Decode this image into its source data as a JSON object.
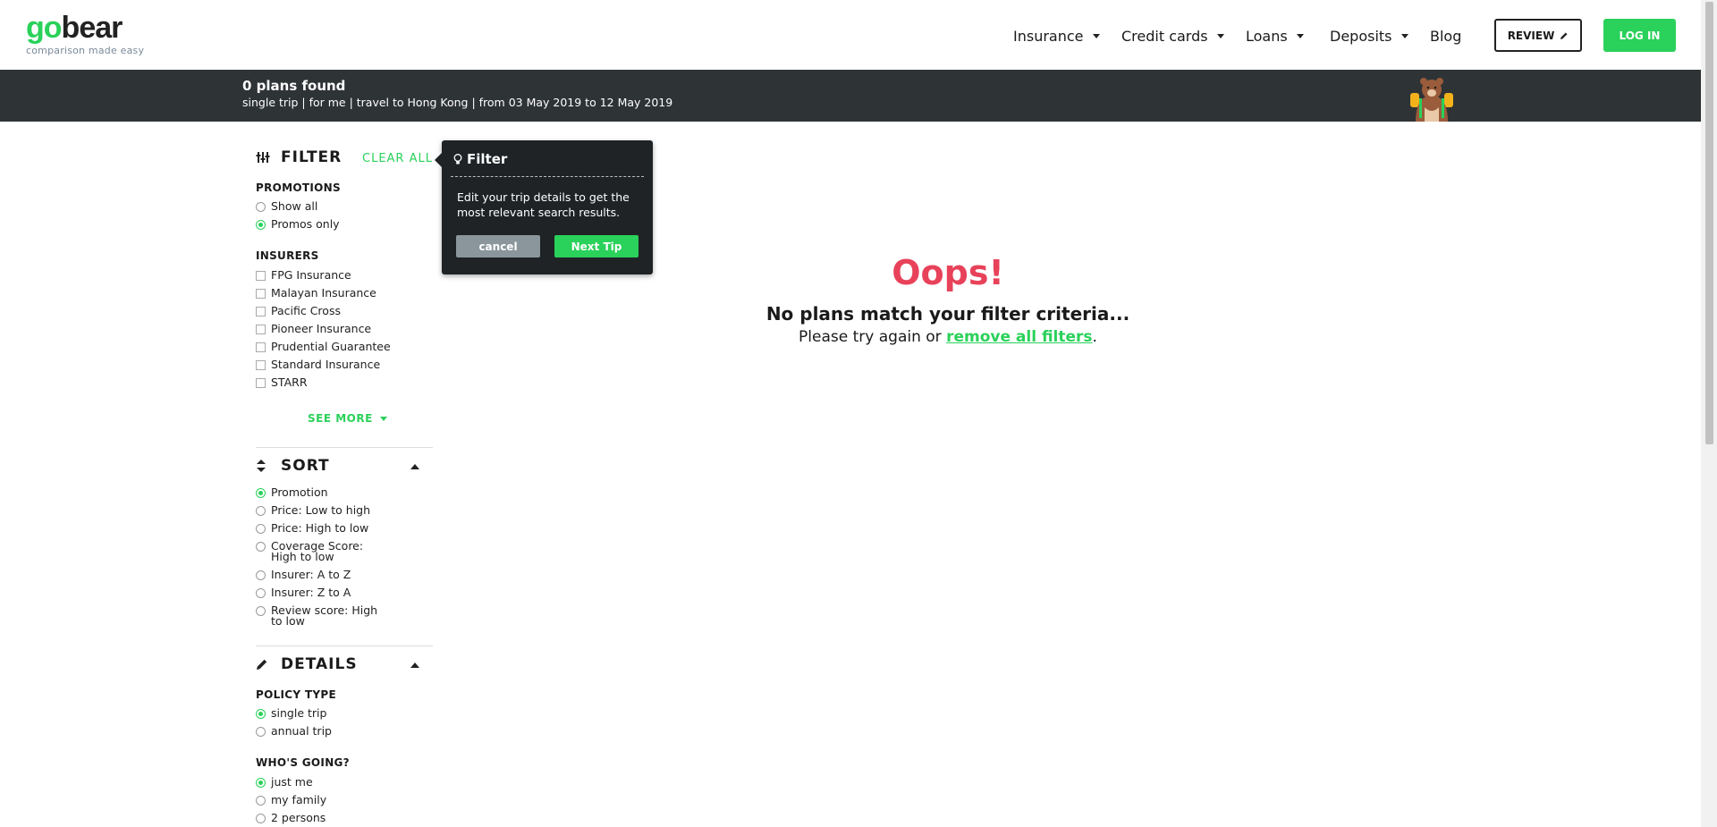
{
  "header": {
    "logo_go": "go",
    "logo_bear": "bear",
    "logo_tagline": "comparison made easy",
    "nav": [
      {
        "label": "Insurance",
        "dropdown": true
      },
      {
        "label": "Credit cards",
        "dropdown": true
      },
      {
        "label": "Loans",
        "dropdown": true
      },
      {
        "label": "Deposits",
        "dropdown": true
      },
      {
        "label": "Blog",
        "dropdown": false
      }
    ],
    "review_label": "REVIEW",
    "login_label": "LOG IN"
  },
  "summary": {
    "title": "0 plans found",
    "subtitle": "single trip | for me | travel to Hong Kong | from 03 May 2019 to 12 May 2019"
  },
  "filter": {
    "title": "FILTER",
    "clear_all": "CLEAR ALL",
    "promotions": {
      "label": "PROMOTIONS",
      "options": [
        {
          "label": "Show all",
          "selected": false
        },
        {
          "label": "Promos only",
          "selected": true
        }
      ]
    },
    "insurers": {
      "label": "INSURERS",
      "options": [
        {
          "label": "FPG Insurance",
          "checked": false
        },
        {
          "label": "Malayan Insurance",
          "checked": false
        },
        {
          "label": "Pacific Cross",
          "checked": false
        },
        {
          "label": "Pioneer Insurance",
          "checked": false
        },
        {
          "label": "Prudential Guarantee",
          "checked": false
        },
        {
          "label": "Standard Insurance",
          "checked": false
        },
        {
          "label": "STARR",
          "checked": false
        }
      ]
    },
    "see_more": "SEE MORE"
  },
  "sort": {
    "title": "SORT",
    "options": [
      {
        "label": "Promotion",
        "selected": true
      },
      {
        "label": "Price: Low to high",
        "selected": false
      },
      {
        "label": "Price: High to low",
        "selected": false
      },
      {
        "label": "Coverage Score: High to low",
        "selected": false
      },
      {
        "label": "Insurer: A to Z",
        "selected": false
      },
      {
        "label": "Insurer: Z to A",
        "selected": false
      },
      {
        "label": "Review score: High to low",
        "selected": false
      }
    ]
  },
  "details": {
    "title": "DETAILS",
    "policy_type": {
      "label": "POLICY TYPE",
      "options": [
        {
          "label": "single trip",
          "selected": true
        },
        {
          "label": "annual trip",
          "selected": false
        }
      ]
    },
    "whos_going": {
      "label": "WHO'S GOING?",
      "options": [
        {
          "label": "just me",
          "selected": true
        },
        {
          "label": "my family",
          "selected": false
        },
        {
          "label": "2 persons",
          "selected": false
        }
      ]
    }
  },
  "tooltip": {
    "title": "Filter",
    "text": "Edit your trip details to get the most relevant search results.",
    "cancel_label": "cancel",
    "next_label": "Next Tip"
  },
  "empty_state": {
    "heading": "Oops!",
    "message": "No plans match your filter criteria...",
    "retry_prefix": "Please try again or ",
    "retry_link": "remove all filters",
    "retry_suffix": "."
  },
  "colors": {
    "brand_green": "#2ad15a",
    "dark_bar": "#2e3336",
    "oops_red": "#e8425a"
  }
}
